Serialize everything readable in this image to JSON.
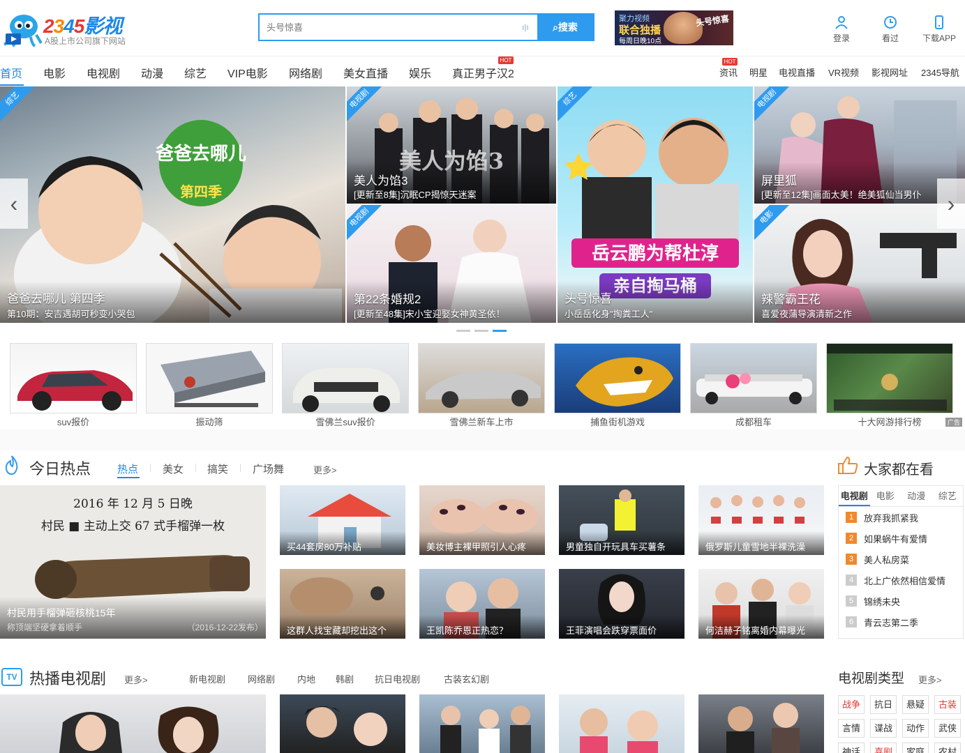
{
  "header": {
    "logo_text": "2345影视",
    "logo_sub": "A股上市公司旗下网站",
    "search_placeholder": "头号惊喜",
    "search_button": "搜索",
    "ad": {
      "line1": "聚力视频",
      "line2": "联合独播",
      "line3": "每周日晚10点",
      "line4": "头号惊喜"
    },
    "icons": [
      {
        "label": "登录",
        "icon": "user-icon"
      },
      {
        "label": "看过",
        "icon": "clock-icon"
      },
      {
        "label": "下载APP",
        "icon": "phone-icon"
      }
    ]
  },
  "nav": {
    "left": [
      "首页",
      "电影",
      "电视剧",
      "动漫",
      "综艺",
      "VIP电影",
      "网络剧",
      "美女直播",
      "娱乐",
      "真正男子汉2"
    ],
    "right": [
      "资讯",
      "明星",
      "电视直播",
      "VR视频",
      "影视网址",
      "2345导航"
    ],
    "hot_label": "HOT"
  },
  "banner": {
    "tiles": [
      {
        "tag": "综艺",
        "title": "爸爸去哪儿 第四季",
        "sub": "第10期：安吉遇胡可秒变小哭包"
      },
      {
        "tag": "电视剧",
        "title": "美人为馅3",
        "sub": "[更新至8集]沉眠CP揭惊天迷案"
      },
      {
        "tag": "电视剧",
        "title": "第22条婚规2",
        "sub": "[更新至48集]宋小宝迎娶女神黄圣依！"
      },
      {
        "tag": "综艺",
        "title": "头号惊喜",
        "sub": "小岳岳化身\"掏粪工人\""
      },
      {
        "tag": "电视剧",
        "title": "屏里狐",
        "sub": "[更新至12集]画面太美！绝美狐仙当男仆"
      },
      {
        "tag": "电影",
        "title": "辣警霸王花",
        "sub": "喜爱夜蒲导演清新之作"
      }
    ],
    "poster_text": {
      "baba": "爸爸去哪儿",
      "season": "第四季",
      "meiren": "美人为馅3",
      "yue": "岳云鹏为帮杜淳",
      "qin": "亲自掏马桶"
    }
  },
  "ads": {
    "items": [
      "suv报价",
      "振动筛",
      "雪佛兰suv报价",
      "雪佛兰新车上市",
      "捕鱼街机游戏",
      "成都租车",
      "十大网游排行榜"
    ],
    "mark": "广告"
  },
  "hot_today": {
    "title": "今日热点",
    "tabs": [
      "热点",
      "美女",
      "搞笑",
      "广场舞"
    ],
    "more": "更多>",
    "lead": {
      "caption": "村民用手榴弹砸核桃15年",
      "sub": "称顶端坚硬拿着顺手",
      "date": "（2016-12-22发布）",
      "doc_line1": "2016 年 12 月 5 日晚",
      "doc_line2": "村民 ■ 主动上交 67 式手榴弹一枚"
    },
    "cards": [
      "买44套房80万补贴",
      "美妆博主裸甲照引人心疼",
      "男童独自开玩具车买薯条",
      "俄罗斯儿童雪地半裸洗澡",
      "这群人找宝藏却挖出这个",
      "王凯陈乔恩正热恋？",
      "王菲演唱会跌穿票面价",
      "何洁赫子铭离婚内幕曝光"
    ]
  },
  "everyone_watch": {
    "title": "大家都在看",
    "tabs": [
      "电视剧",
      "电影",
      "动漫",
      "综艺"
    ],
    "items": [
      "放弃我抓紧我",
      "如果蜗牛有爱情",
      "美人私房菜",
      "北上广依然相信爱情",
      "锦绣未央",
      "青云志第二季"
    ]
  },
  "hot_tv": {
    "title": "热播电视剧",
    "badge": "TV",
    "more": "更多>",
    "tabs": [
      "新电视剧",
      "网络剧",
      "内地",
      "韩剧",
      "抗日电视剧",
      "古装玄幻剧"
    ]
  },
  "tv_genres": {
    "title": "电视剧类型",
    "more": "更多>",
    "items": [
      "战争",
      "抗日",
      "悬疑",
      "古装",
      "言情",
      "谍战",
      "动作",
      "武侠",
      "神话",
      "喜剧",
      "家庭",
      "农村"
    ]
  },
  "colors": {
    "accent": "#2e9bef",
    "hot": "#e53935",
    "rank": "#f0892c"
  }
}
